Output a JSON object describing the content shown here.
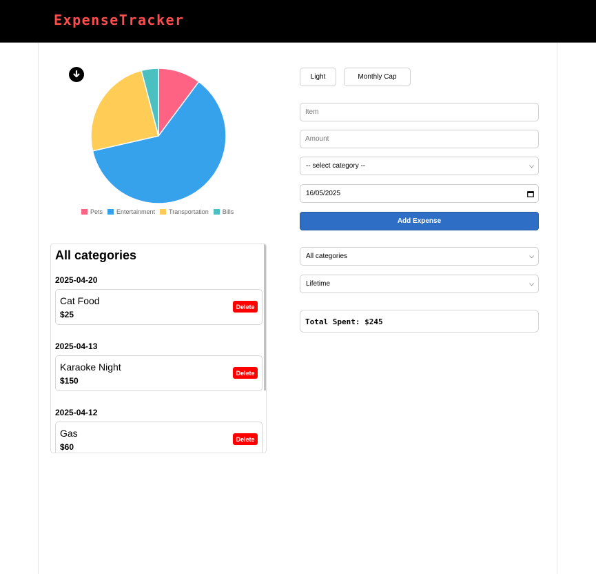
{
  "header": {
    "brand": "ExpenseTracker",
    "brand_color": "#ff4d4d"
  },
  "chart": {
    "download_icon": "download-icon",
    "chart_data": {
      "type": "pie",
      "title": "",
      "legend_position": "bottom",
      "categories": [
        "Pets",
        "Entertainment",
        "Transportation",
        "Bills"
      ],
      "values": [
        25,
        150,
        60,
        10
      ],
      "colors": [
        "#ff6384",
        "#36a2eb",
        "#ffcd56",
        "#4bc0c0"
      ]
    }
  },
  "toolbar": {
    "theme_label": "Light",
    "monthly_cap_label": "Monthly Cap"
  },
  "form": {
    "item_placeholder": "Item",
    "amount_placeholder": "Amount",
    "category_selected": "-- select category --",
    "date_value": "16/05/2025",
    "add_label": "Add Expense"
  },
  "filters": {
    "category_selected": "All categories",
    "period_selected": "Lifetime"
  },
  "summary": {
    "total_label": "Total Spent: $245"
  },
  "list": {
    "title": "All categories",
    "groups": [
      {
        "date": "2025-04-20",
        "items": [
          {
            "name": "Cat Food",
            "amount": "$25",
            "delete_label": "Delete"
          }
        ]
      },
      {
        "date": "2025-04-13",
        "items": [
          {
            "name": "Karaoke Night",
            "amount": "$150",
            "delete_label": "Delete"
          }
        ]
      },
      {
        "date": "2025-04-12",
        "items": [
          {
            "name": "Gas",
            "amount": "$60",
            "delete_label": "Delete"
          }
        ]
      }
    ]
  }
}
